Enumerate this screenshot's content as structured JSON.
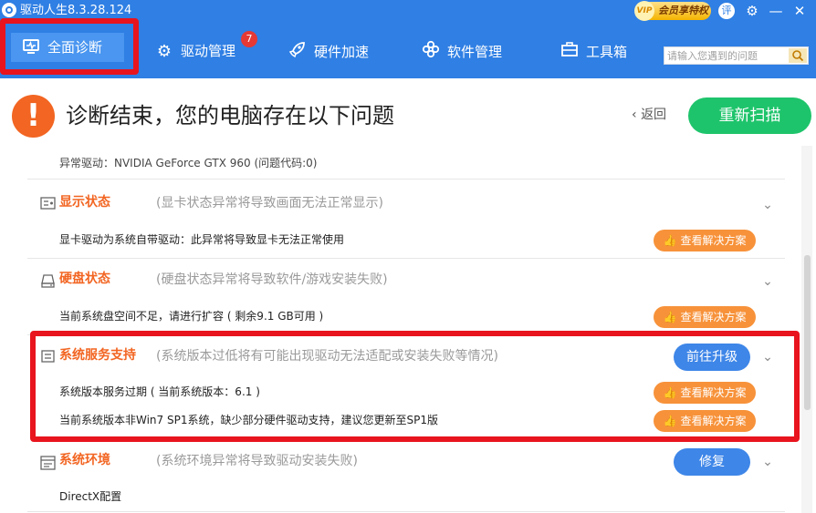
{
  "window": {
    "title": "驱动人生8.3.28.124"
  },
  "titlebar": {
    "vip_badge": "VIP",
    "vip_label": "会员享特权",
    "comment_icon_text": "评",
    "settings_icon": "⚙",
    "minimize_icon": "—",
    "close_icon": "✕"
  },
  "nav": {
    "items": [
      {
        "label": "全面诊断",
        "icon": "monitor-icon",
        "active": true
      },
      {
        "label": "驱动管理",
        "icon": "gear-icon",
        "badge": "7"
      },
      {
        "label": "硬件加速",
        "icon": "rocket-icon"
      },
      {
        "label": "软件管理",
        "icon": "flower-icon"
      },
      {
        "label": "工具箱",
        "icon": "toolbox-icon"
      }
    ],
    "search_placeholder": "请输入您遇到的问题"
  },
  "header": {
    "icon": "!",
    "title": "诊断结束，您的电脑存在以下问题",
    "back_label": "返回",
    "rescan_label": "重新扫描"
  },
  "issues": {
    "top_partial_row": "异常驱动：NVIDIA GeForce GTX 960 (问题代码:0)",
    "sections": [
      {
        "title": "显示状态",
        "desc": "(显卡状态异常将导致画面无法正常显示)",
        "rows": [
          {
            "text": "显卡驱动为系统自带驱动：此异常将导致显卡无法正常使用",
            "action": "查看解决方案"
          }
        ]
      },
      {
        "title": "硬盘状态",
        "desc": "(硬盘状态异常将导致软件/游戏安装失败)",
        "rows": [
          {
            "text": "当前系统盘空间不足，请进行扩容 ( 剩余9.1 GB可用 )",
            "action": "查看解决方案"
          }
        ]
      },
      {
        "title": "系统服务支持",
        "desc": "(系统版本过低将有可能出现驱动无法适配或安装失败等情况)",
        "button": "前往升级",
        "rows": [
          {
            "text": "系统版本服务过期 ( 当前系统版本：6.1 )",
            "action": "查看解决方案"
          },
          {
            "text": "当前系统版本非Win7 SP1系统，缺少部分硬件驱动支持，建议您更新至SP1版",
            "action": "查看解决方案"
          }
        ]
      },
      {
        "title": "系统环境",
        "desc": "(系统环境异常将导致驱动安装失败)",
        "button": "修复",
        "rows": [
          {
            "text": "DirectX配置"
          }
        ]
      }
    ]
  },
  "colors": {
    "primary": "#2f7fe4",
    "accent_orange": "#f26522",
    "green": "#1ec46b",
    "highlight_red": "#e8141e"
  }
}
